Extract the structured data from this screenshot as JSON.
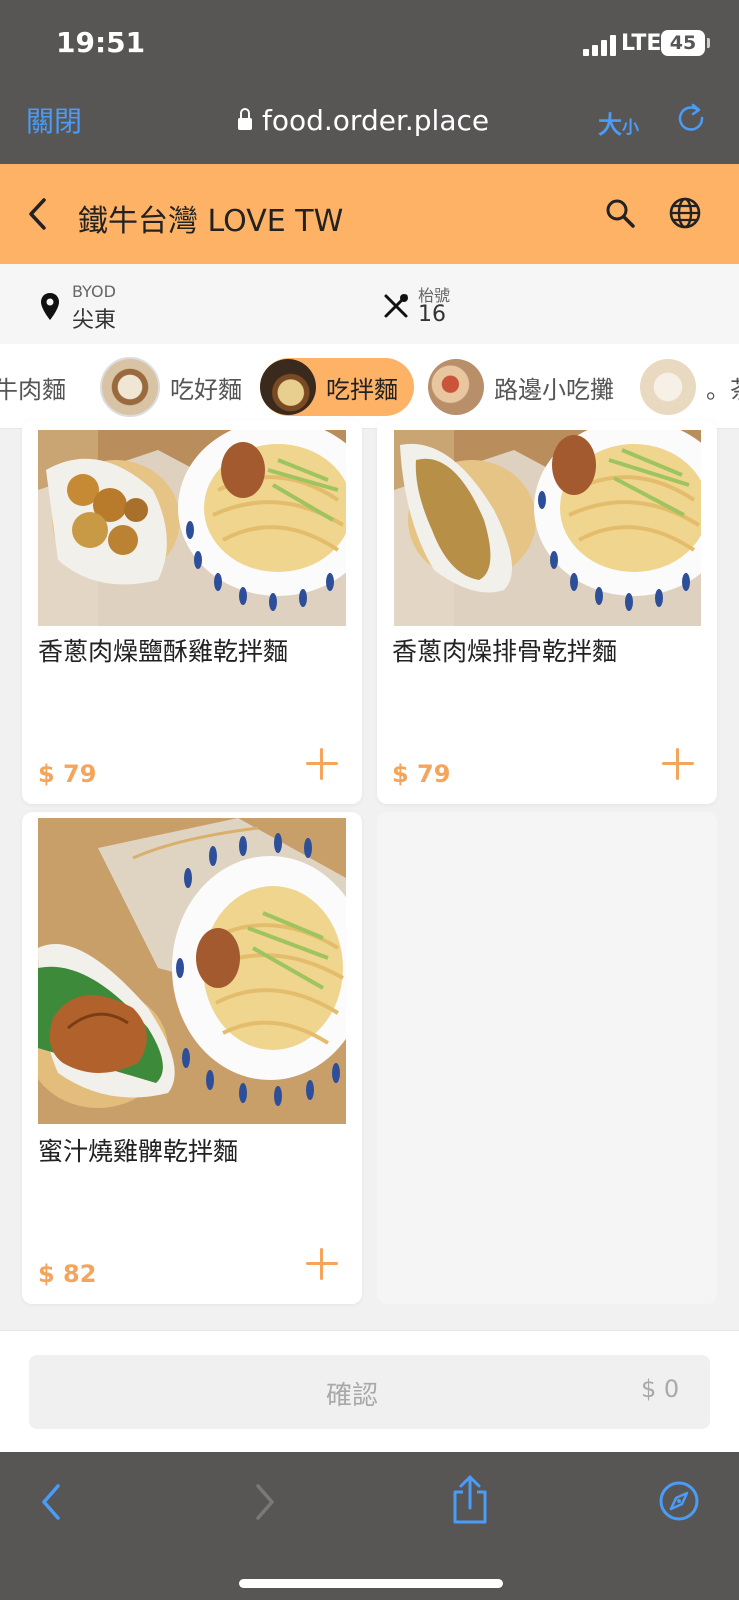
{
  "status_bar": {
    "time": "19:51",
    "network": "LTE",
    "battery": "45"
  },
  "browser": {
    "close_label": "關閉",
    "url": "food.order.place",
    "text_size_big": "大",
    "text_size_small": "小"
  },
  "header": {
    "title": "鐵牛台灣 LOVE TW"
  },
  "info": {
    "store_label": "BYOD",
    "store_value": "尖東",
    "table_label": "枱號",
    "table_value": "16"
  },
  "categories": [
    {
      "label": "牛肉麵"
    },
    {
      "label": "吃好麵"
    },
    {
      "label": "吃拌麵",
      "active": true
    },
    {
      "label": "路邊小吃攤"
    },
    {
      "label": "。茶"
    }
  ],
  "products": [
    {
      "name": "香蔥肉燥鹽酥雞乾拌麵",
      "price": "$ 79"
    },
    {
      "name": "香蔥肉燥排骨乾拌麵",
      "price": "$ 79"
    },
    {
      "name": "蜜汁燒雞髀乾拌麵",
      "price": "$ 82"
    }
  ],
  "footer": {
    "confirm_label": "確認",
    "total": "$ 0"
  },
  "colors": {
    "accent": "#fdb266",
    "price": "#f5a55b",
    "browser_chrome": "#575655",
    "ios_blue": "#4a9cf7"
  }
}
